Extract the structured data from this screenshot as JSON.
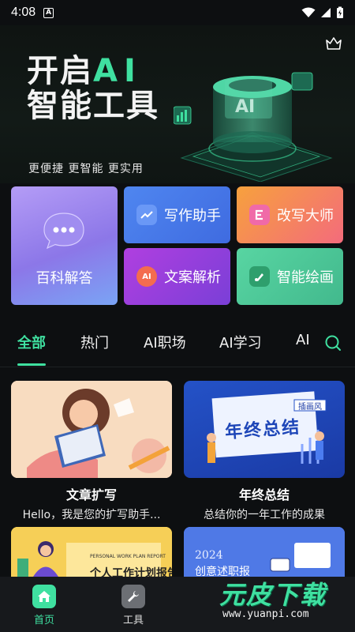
{
  "status_bar": {
    "time": "4:08",
    "notif_letter": "A"
  },
  "hero": {
    "title_line1_prefix": "开启",
    "title_line1_ai": "AI",
    "title_line2": "智能工具",
    "subtitle": "更便捷  更智能  更实用",
    "accent_color": "#3fe0a0"
  },
  "features": {
    "big": {
      "label": "百科解答",
      "icon": "chat-bubble-icon"
    },
    "items": [
      {
        "label": "写作助手",
        "icon": "trend-chart-icon"
      },
      {
        "label": "改写大师",
        "icon": "e-letter-icon"
      },
      {
        "label": "文案解析",
        "icon": "ai-circle-icon"
      },
      {
        "label": "智能绘画",
        "icon": "paint-brush-icon"
      }
    ]
  },
  "tabs": [
    {
      "label": "全部",
      "active": true
    },
    {
      "label": "热门"
    },
    {
      "label": "AI职场"
    },
    {
      "label": "AI学习"
    },
    {
      "label": "AI"
    }
  ],
  "templates": [
    {
      "title": "文章扩写",
      "desc": "Hello，我是您的扩写助手..."
    },
    {
      "title": "年终总结",
      "desc": "总结你的一年工作的成果",
      "thumb_text": "年终总结",
      "thumb_tag": "插画风"
    },
    {
      "title": "",
      "desc": "",
      "thumb_text": "个人工作计划报告",
      "thumb_small": "PERSONAL WORK PLAN REPORT"
    },
    {
      "title": "",
      "desc": "",
      "thumb_year": "2024",
      "thumb_text": "创意述职报"
    }
  ],
  "bottom_nav": [
    {
      "label": "首页",
      "icon": "home-icon",
      "active": true
    },
    {
      "label": "工具",
      "icon": "wrench-icon"
    }
  ],
  "watermark": {
    "text": "元皮下载",
    "url": "www.yuanpi.com"
  }
}
